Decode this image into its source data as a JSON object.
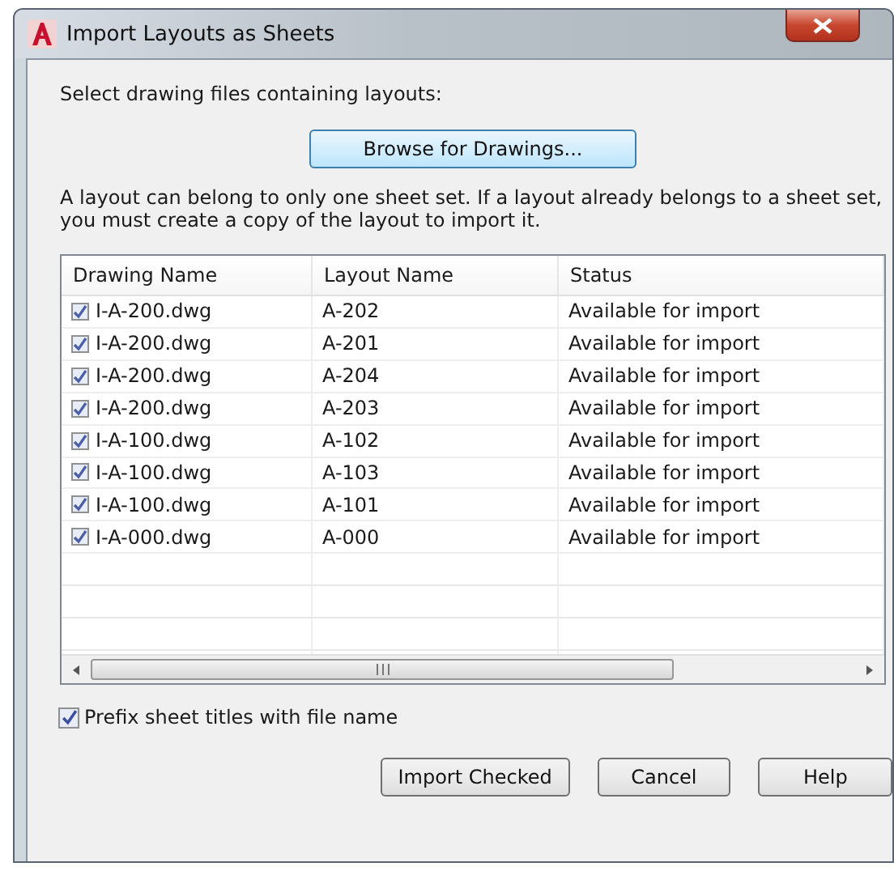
{
  "window": {
    "title": "Import Layouts as Sheets"
  },
  "intro": "Select drawing files containing layouts:",
  "browse_button": "Browse for Drawings...",
  "note": "A layout can belong to only one sheet set. If a layout already belongs to a sheet set, you must create a copy of the layout to import it.",
  "table": {
    "columns": [
      "Drawing Name",
      "Layout Name",
      "Status"
    ],
    "rows": [
      {
        "checked": true,
        "drawing": "I-A-200.dwg",
        "layout": "A-202",
        "status": "Available for import"
      },
      {
        "checked": true,
        "drawing": "I-A-200.dwg",
        "layout": "A-201",
        "status": "Available for import"
      },
      {
        "checked": true,
        "drawing": "I-A-200.dwg",
        "layout": "A-204",
        "status": "Available for import"
      },
      {
        "checked": true,
        "drawing": "I-A-200.dwg",
        "layout": "A-203",
        "status": "Available for import"
      },
      {
        "checked": true,
        "drawing": "I-A-100.dwg",
        "layout": "A-102",
        "status": "Available for import"
      },
      {
        "checked": true,
        "drawing": "I-A-100.dwg",
        "layout": "A-103",
        "status": "Available for import"
      },
      {
        "checked": true,
        "drawing": "I-A-100.dwg",
        "layout": "A-101",
        "status": "Available for import"
      },
      {
        "checked": true,
        "drawing": "I-A-000.dwg",
        "layout": "A-000",
        "status": "Available for import"
      }
    ]
  },
  "prefix_option": {
    "label": "Prefix sheet titles with file name",
    "checked": true
  },
  "buttons": [
    "Import Checked",
    "Cancel",
    "Help"
  ]
}
